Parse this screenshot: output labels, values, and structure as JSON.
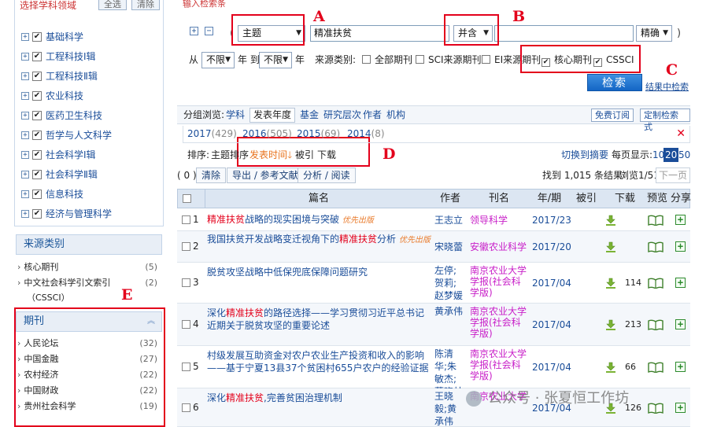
{
  "left_panel": {
    "header_title": "选择学科领域",
    "header_buttons": [
      "全选",
      "清除"
    ],
    "categories": [
      "基础科学",
      "工程科技Ⅰ辑",
      "工程科技Ⅱ辑",
      "农业科技",
      "医药卫生科技",
      "哲学与人文科学",
      "社会科学Ⅰ辑",
      "社会科学Ⅱ辑",
      "信息科技",
      "经济与管理科学"
    ],
    "source_panel": {
      "title": "来源类别",
      "items": [
        {
          "label": "核心期刊",
          "count": "(5)"
        },
        {
          "label": "中文社会科学引文索引",
          "label2": "（CSSCI）",
          "count": "(2)"
        }
      ]
    },
    "journal_panel": {
      "title": "期刊",
      "items": [
        {
          "label": "人民论坛",
          "count": "(32)"
        },
        {
          "label": "中国金融",
          "count": "(27)"
        },
        {
          "label": "农村经济",
          "count": "(22)"
        },
        {
          "label": "中国财政",
          "count": "(22)"
        },
        {
          "label": "贵州社会科学",
          "count": "(19)"
        }
      ]
    }
  },
  "annotations": {
    "a": "A",
    "b": "B",
    "c": "C",
    "d": "D",
    "e": "E"
  },
  "search": {
    "top_hint": "输入检索条件：",
    "field": "主题",
    "keyword": "精准扶贫",
    "logic": "并含",
    "second_keyword": "",
    "match": "精确",
    "from_label": "从",
    "year_from": "不限",
    "year_to_label": "年 到",
    "year_to": "不限",
    "year_suffix": "年",
    "source_label": "来源类别:",
    "source_options": [
      {
        "label": "全部期刊",
        "checked": false
      },
      {
        "label": "SCI来源期刊",
        "checked": false
      },
      {
        "label": "EI来源期刊",
        "checked": false
      },
      {
        "label": "核心期刊",
        "checked": true
      },
      {
        "label": "CSSCI",
        "checked": true
      }
    ],
    "search_button": "检索",
    "within_link": "结果中检索"
  },
  "group_bar": {
    "label": "分组浏览:",
    "items": [
      "学科",
      "发表年度",
      "基金",
      "研究层次",
      "作者",
      "机构"
    ],
    "active": "发表年度",
    "buttons": [
      "免费订阅",
      "定制检索式"
    ]
  },
  "years": [
    {
      "year": "2017",
      "count": "(429)"
    },
    {
      "year": "2016",
      "count": "(505)"
    },
    {
      "year": "2015",
      "count": "(69)"
    },
    {
      "year": "2014",
      "count": "(8)"
    }
  ],
  "sort": {
    "label": "排序:",
    "items": [
      "主题排序",
      "发表时间",
      "被引",
      "下载"
    ],
    "active": "发表时间",
    "switch": "切换到摘要",
    "per_page_label": "每页显示:",
    "per_page": [
      "10",
      "20",
      "50"
    ],
    "per_page_active": "20"
  },
  "toolbar": {
    "selected": "( 0 )",
    "clear": "清除",
    "export": "导出 / 参考文献",
    "analyze": "分析 / 阅读",
    "found": "找到 1,015 条结果",
    "browse": "浏览1/51",
    "next": "下一页"
  },
  "table": {
    "headers": [
      "篇名",
      "作者",
      "刊名",
      "年/期",
      "被引",
      "下载",
      "预览",
      "分享"
    ],
    "rows": [
      {
        "num": "1",
        "title_parts": [
          {
            "t": "精准扶贫",
            "hl": true
          },
          {
            "t": "战略的现实困境与突破",
            "hl": false
          }
        ],
        "first": "优先出版",
        "author": "王志立",
        "source": "领导科学",
        "issue": "2017/23",
        "cited": "",
        "downloads": ""
      },
      {
        "num": "2",
        "title_parts": [
          {
            "t": "我国扶贫开发战略变迁视角下的",
            "hl": false
          },
          {
            "t": "精准扶贫",
            "hl": true
          },
          {
            "t": "分析",
            "hl": false
          }
        ],
        "first": "优先出版",
        "author": "宋晓蕾",
        "source": "安徽农业科学",
        "issue": "2017/20",
        "cited": "",
        "downloads": ""
      },
      {
        "num": "3",
        "title_parts": [
          {
            "t": "脱贫攻坚战略中低保兜底保障问题研究",
            "hl": false
          }
        ],
        "first": "",
        "author": "左停;贺莉;赵梦媛",
        "source": "南京农业大学学报(社会科学版)",
        "issue": "2017/04",
        "cited": "",
        "downloads": "114"
      },
      {
        "num": "4",
        "title_parts": [
          {
            "t": "深化",
            "hl": false
          },
          {
            "t": "精准扶贫",
            "hl": true
          },
          {
            "t": "的路径选择——学习贯彻习近平总书记近期关于脱贫攻坚的重要论述",
            "hl": false
          }
        ],
        "first": "",
        "author": "黄承伟",
        "source": "南京农业大学学报(社会科学版)",
        "issue": "2017/04",
        "cited": "",
        "downloads": "213"
      },
      {
        "num": "5",
        "title_parts": [
          {
            "t": "村级发展互助资金对农户农业生产投资和收入的影响——基于宁夏13县37个贫困村655户农户的经验证据",
            "hl": false
          }
        ],
        "first": "",
        "author": "陈清华;朱敏杰;董晓林",
        "source": "南京农业大学学报(社会科学版)",
        "issue": "2017/04",
        "cited": "",
        "downloads": "66"
      },
      {
        "num": "6",
        "title_parts": [
          {
            "t": "深化",
            "hl": false
          },
          {
            "t": "精准扶贫",
            "hl": true
          },
          {
            "t": ",完善贫困治理机制",
            "hl": false
          }
        ],
        "first": "",
        "author": "王晓毅;黄承伟",
        "source": "南京农业大学",
        "issue": "2017/04",
        "cited": "",
        "downloads": "126"
      }
    ]
  },
  "watermark": "公众号 · 张夏恒工作坊"
}
